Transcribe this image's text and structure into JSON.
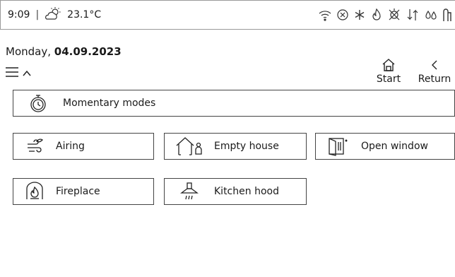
{
  "status": {
    "time": "9:09",
    "separator": "|",
    "temperature": "23.1°C",
    "icons": [
      "sun-cloud-icon",
      "wifi-icon",
      "error-circle-icon",
      "snowflake-icon",
      "fire-icon",
      "heat-icon",
      "airflow-icon",
      "humidity-icon",
      "filter-icon"
    ]
  },
  "header": {
    "weekday": "Monday,",
    "date": "04.09.2023"
  },
  "nav": {
    "start_label": "Start",
    "return_label": "Return"
  },
  "modes": {
    "momentary": "Momentary modes",
    "airing": "Airing",
    "empty_house": "Empty house",
    "open_window": "Open window",
    "fireplace": "Fireplace",
    "kitchen_hood": "Kitchen hood"
  }
}
